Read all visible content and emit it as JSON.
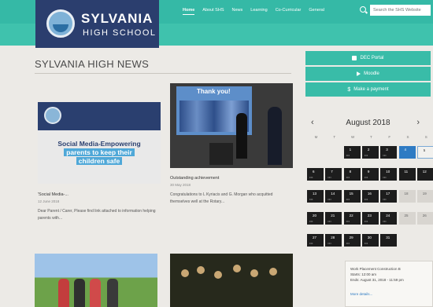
{
  "header": {
    "logo_line1": "SYLVANIA",
    "logo_line2": "HIGH SCHOOL",
    "nav": [
      "Home",
      "About SHS",
      "News",
      "Learning",
      "Co-Curricular",
      "General"
    ],
    "search_placeholder": "Search the SHS Website"
  },
  "main": {
    "title": "SYLVANIA HIGH NEWS",
    "posts": [
      {
        "thumb_text": [
          "Social Media-Empowering",
          "parents to keep their",
          "children safe"
        ],
        "title": "'Social Media-...",
        "date": "12 June 2018",
        "excerpt": "Dear Parent / Carer, Please find link attached to information helping parents with..."
      },
      {
        "thumb_text": [
          "Thank you!"
        ],
        "title": "Outstanding achievement",
        "date": "30 May 2018",
        "excerpt": "Congratulations to L Kyriacis and G. Morgan who acquitted themselves well at the Rotary..."
      }
    ]
  },
  "sidebar": {
    "buttons": [
      {
        "label": "DEC Portal",
        "icon": "portal-icon"
      },
      {
        "label": "Moodle",
        "icon": "play-icon"
      },
      {
        "label": "Make a payment",
        "icon": "dollar-icon"
      }
    ],
    "calendar": {
      "prev": "‹",
      "next": "›",
      "month": "August 2018",
      "weekdays": [
        "M",
        "T",
        "W",
        "T",
        "F",
        "S",
        "S"
      ],
      "days": [
        [
          "",
          "",
          "1",
          "2",
          "3",
          "4",
          "5"
        ],
        [
          "6",
          "7",
          "8",
          "9",
          "10",
          "11",
          "12"
        ],
        [
          "13",
          "14",
          "15",
          "16",
          "17",
          "18",
          "19"
        ],
        [
          "20",
          "21",
          "22",
          "23",
          "24",
          "25",
          "26"
        ],
        [
          "27",
          "28",
          "29",
          "30",
          "31",
          "",
          ""
        ]
      ]
    },
    "event": {
      "title": "Work Placement Construction B",
      "starts": "Starts: 12:00 am",
      "ends": "Ends: August 31, 2018 - 11:59 pm",
      "more": "More details..."
    }
  },
  "colors": {
    "teal": "#35b9a6",
    "navy": "#2b3e6e",
    "background": "#eceae6"
  }
}
